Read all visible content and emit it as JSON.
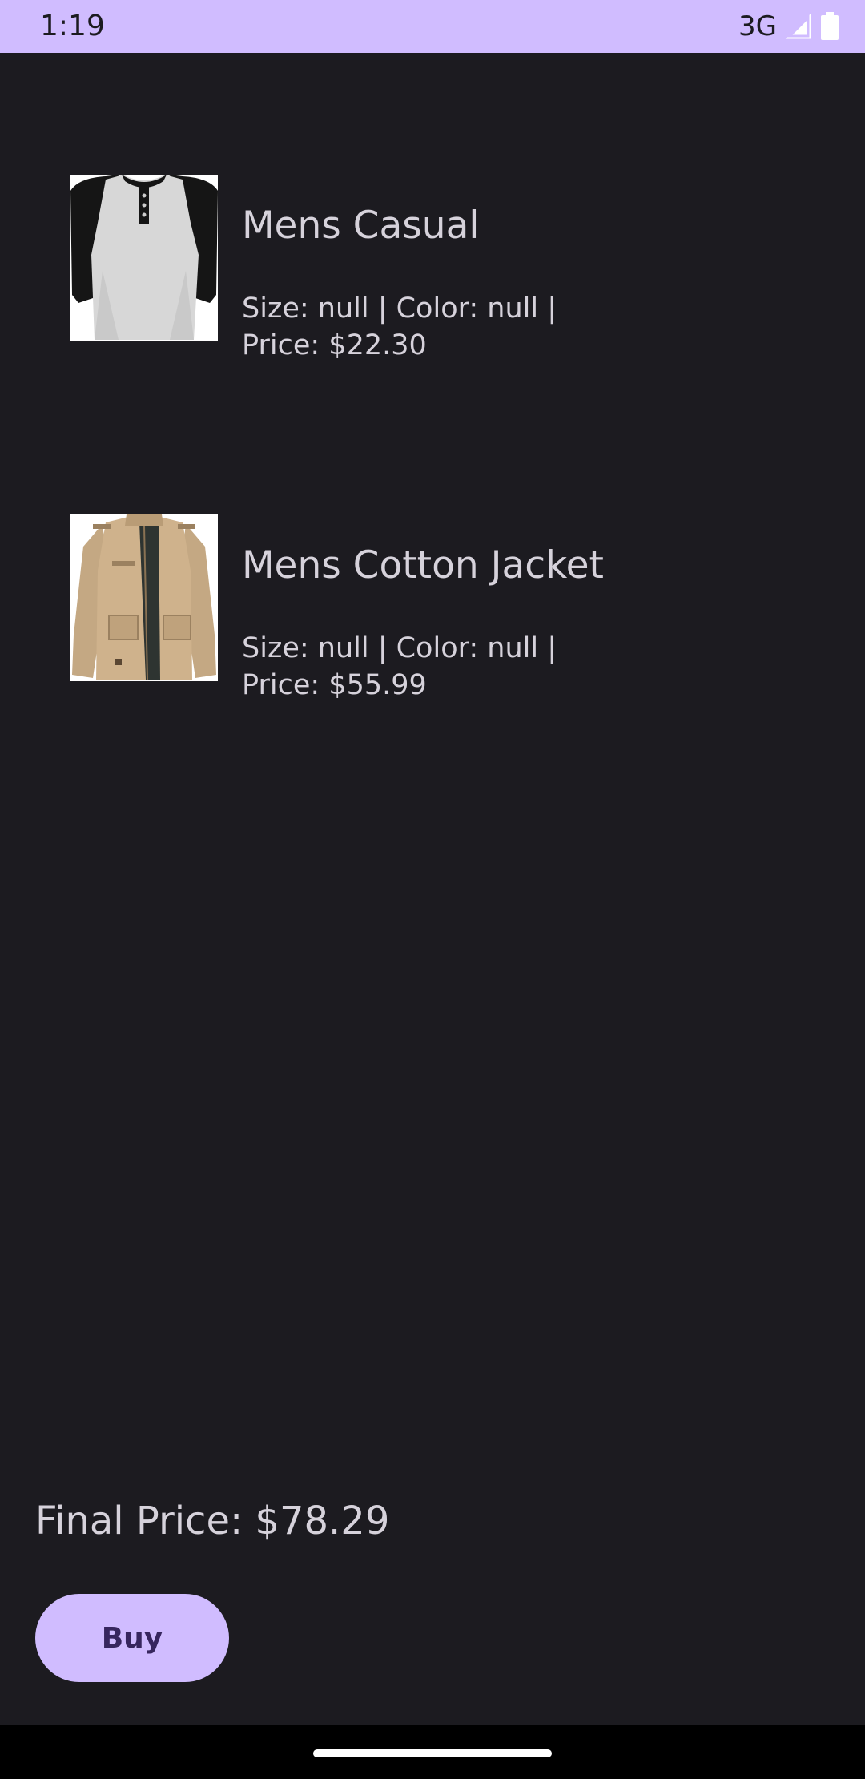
{
  "status_bar": {
    "time": "1:19",
    "network": "3G",
    "background": "#d0bcff",
    "signal_icon": "cellular-signal-icon",
    "battery_icon": "battery-icon"
  },
  "cart": {
    "items": [
      {
        "title": "Mens Casual",
        "details": "Size: null | Color: null | Price: $22.30",
        "image": "raglan-henley-shirt-image"
      },
      {
        "title": "Mens Cotton Jacket",
        "details": "Size: null | Color: null | Price: $55.99",
        "image": "khaki-cotton-jacket-image"
      }
    ]
  },
  "footer": {
    "final_price": "Final Price: $78.29",
    "buy_label": "Buy"
  },
  "colors": {
    "background": "#1c1b20",
    "accent": "#d0bcff",
    "button_text": "#37265e",
    "text": "#d6d2db"
  }
}
